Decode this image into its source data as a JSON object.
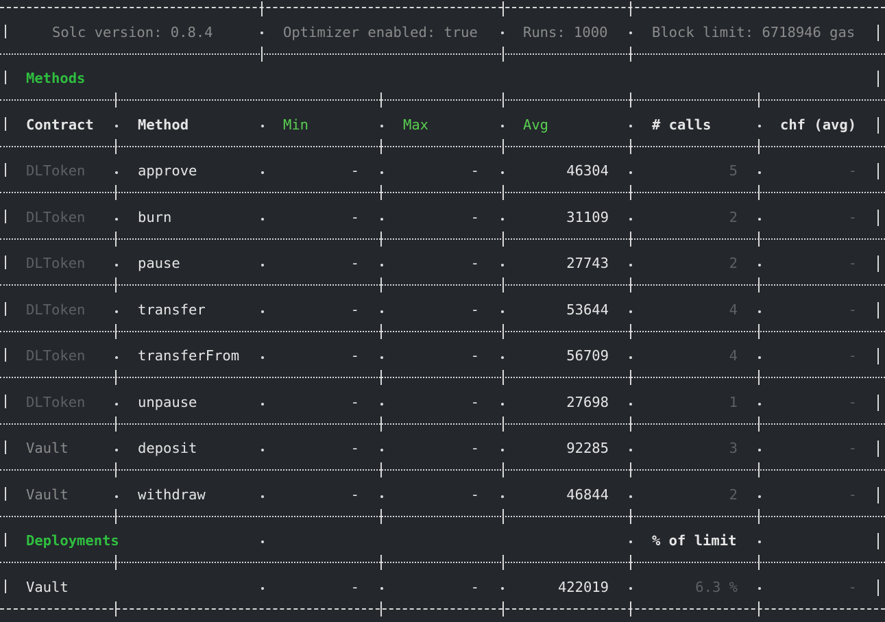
{
  "header": {
    "solc": "Solc version: 0.8.4",
    "optimizer": "Optimizer enabled: true",
    "runs": "Runs: 1000",
    "block_limit": "Block limit: 6718946 gas"
  },
  "methods_section": {
    "title": "Methods",
    "columns": [
      "Contract",
      "Method",
      "Min",
      "Max",
      "Avg",
      "# calls",
      "chf (avg)"
    ],
    "rows": [
      {
        "contract": "DLToken",
        "method": "approve",
        "min": "-",
        "max": "-",
        "avg": "46304",
        "calls": "5",
        "chf": "-"
      },
      {
        "contract": "DLToken",
        "method": "burn",
        "min": "-",
        "max": "-",
        "avg": "31109",
        "calls": "2",
        "chf": "-"
      },
      {
        "contract": "DLToken",
        "method": "pause",
        "min": "-",
        "max": "-",
        "avg": "27743",
        "calls": "2",
        "chf": "-"
      },
      {
        "contract": "DLToken",
        "method": "transfer",
        "min": "-",
        "max": "-",
        "avg": "53644",
        "calls": "4",
        "chf": "-"
      },
      {
        "contract": "DLToken",
        "method": "transferFrom",
        "min": "-",
        "max": "-",
        "avg": "56709",
        "calls": "4",
        "chf": "-"
      },
      {
        "contract": "DLToken",
        "method": "unpause",
        "min": "-",
        "max": "-",
        "avg": "27698",
        "calls": "1",
        "chf": "-"
      },
      {
        "contract": "Vault",
        "method": "deposit",
        "min": "-",
        "max": "-",
        "avg": "92285",
        "calls": "3",
        "chf": "-"
      },
      {
        "contract": "Vault",
        "method": "withdraw",
        "min": "-",
        "max": "-",
        "avg": "46844",
        "calls": "2",
        "chf": "-"
      }
    ]
  },
  "deployments_section": {
    "title": "Deployments",
    "limit_label": "% of limit",
    "rows": [
      {
        "contract": "Vault",
        "min": "-",
        "max": "-",
        "avg": "422019",
        "pct": "6.3 %",
        "chf": "-"
      }
    ]
  },
  "colors": {
    "background": "#24272c",
    "section_title": "#2fbf3f",
    "gas_headers": "#58cf4f",
    "text": "#e6e6e6",
    "dim": "#8b8b8b",
    "dimmer": "#5d6066"
  }
}
